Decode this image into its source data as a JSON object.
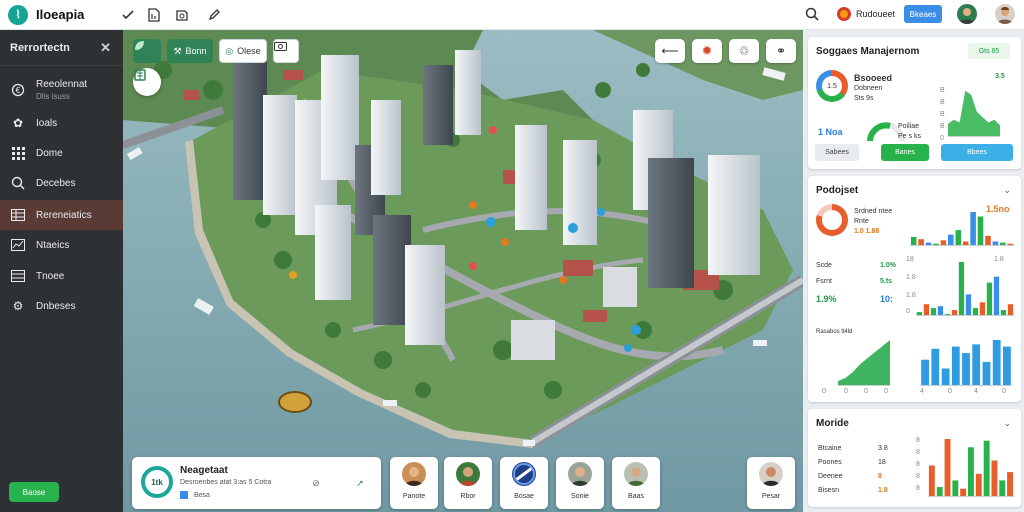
{
  "app": {
    "title": "Iloeapia",
    "logo_glyph": "⌇"
  },
  "topbar": {
    "icons": [
      "check-icon",
      "document-icon",
      "box-icon",
      "edit-icon"
    ],
    "user_name": "Rudoueet",
    "action_button": "Bkeaes"
  },
  "sidebar": {
    "title": "Rerrortectn",
    "items": [
      {
        "label": "Reeolennat",
        "sub": "Dlis isuss",
        "icon": "coin-icon"
      },
      {
        "label": "Ioals",
        "icon": "puzzle-icon"
      },
      {
        "label": "Dome",
        "icon": "grid-icon"
      },
      {
        "label": "Decebes",
        "icon": "search-icon"
      },
      {
        "label": "Rereneiatics",
        "icon": "table-icon"
      },
      {
        "label": "Ntaeics",
        "icon": "chart-icon"
      },
      {
        "label": "Tnoee",
        "icon": "list-icon"
      },
      {
        "label": "Dnbeses",
        "icon": "gear-icon"
      }
    ],
    "active_index": 4,
    "action_button": "Baose"
  },
  "map": {
    "toolbar": [
      "Bonn",
      "Olese"
    ],
    "info_card": {
      "ring_label": "1tk",
      "title": "Neagetaat",
      "text": "Desroenbes atat 3:as 5 Cotra",
      "tag": "Besa"
    },
    "people": [
      "Panote",
      "Rbor",
      "Bosae",
      "Sonie",
      "Baas",
      "Pesar"
    ]
  },
  "panel1": {
    "title": "Soggaes Manajernom",
    "badge": "Gts 85",
    "donut_label": "1.5",
    "legend_title": "Bsooeed",
    "legend_lines": [
      "Dobneen",
      "Sts 9s"
    ],
    "stat_value": "1 Noa",
    "gauge_lines": [
      "Poiliae",
      "Pe s ks"
    ],
    "axis_right": [
      "3.5",
      "B",
      "B",
      "B",
      "B",
      "0"
    ],
    "buttons": [
      "Sabees",
      "Banes",
      "Bbees"
    ]
  },
  "panel2": {
    "title": "Podojset",
    "donut_lines": [
      "Srdned ntee",
      "Rnte",
      "1.0 1.88"
    ],
    "top_value": "1.5no",
    "rows": [
      {
        "label": "Scde",
        "value": "1.0%"
      },
      {
        "label": "Fsrnt",
        "value": "5.ts"
      },
      {
        "label": "1.9%",
        "value": "10:"
      }
    ],
    "side_labels": [
      "18",
      "1.8",
      "1.8",
      "0"
    ],
    "chart1_ticks": [
      "0",
      "0",
      "0",
      "0"
    ],
    "chart2_ticks": [
      "4",
      "0",
      "4",
      "0"
    ],
    "chart_caption": "Rasabos lt4ld"
  },
  "panel3": {
    "title": "Moride",
    "rows": [
      {
        "label": "Btcaine",
        "value": "3.8"
      },
      {
        "label": "Poones",
        "value": "18"
      },
      {
        "label": "Deenee",
        "value": "8"
      },
      {
        "label": "Bisesn",
        "value": "1.8"
      }
    ],
    "ticks": [
      "8",
      "8",
      "8",
      "8",
      "8"
    ]
  },
  "chart_data": [
    {
      "type": "area",
      "name": "panel1-trend",
      "values": [
        20,
        26,
        22,
        70,
        64,
        38,
        30,
        22,
        26,
        18
      ],
      "ylim": [
        0,
        100
      ]
    },
    {
      "type": "bar",
      "name": "panel2-top",
      "values": [
        8,
        6,
        3,
        2,
        5,
        10,
        14,
        4,
        30,
        26,
        9,
        4,
        3,
        2
      ]
    },
    {
      "type": "bar",
      "name": "panel2-mid",
      "values": [
        4,
        12,
        8,
        10,
        2,
        6,
        55,
        22,
        8,
        14,
        34,
        40,
        6,
        12
      ]
    },
    {
      "type": "area",
      "name": "panel2-left",
      "values": [
        5,
        8,
        14,
        22,
        28,
        34,
        40,
        46
      ]
    },
    {
      "type": "bar",
      "name": "panel2-right",
      "values": [
        24,
        34,
        16,
        36,
        30,
        38,
        22,
        42,
        36
      ]
    },
    {
      "type": "bar",
      "name": "panel3",
      "values": [
        38,
        12,
        70,
        20,
        10,
        60,
        28,
        68,
        44,
        20,
        30
      ]
    }
  ]
}
